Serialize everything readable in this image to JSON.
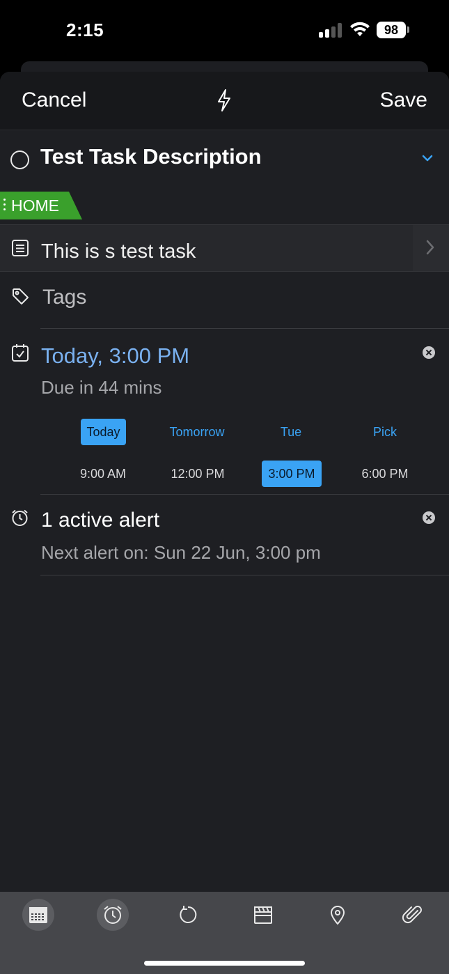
{
  "status_bar": {
    "time": "2:15",
    "battery": "98"
  },
  "nav": {
    "cancel_label": "Cancel",
    "save_label": "Save",
    "center_icon": "bolt-icon"
  },
  "task": {
    "title": "Test Task Description",
    "list_tag": "HOME",
    "list_tag_color": "#3aa02c"
  },
  "notes": {
    "text": "This is s test task"
  },
  "tags": {
    "placeholder": "Tags"
  },
  "due": {
    "date_text": "Today, 3:00 PM",
    "relative_text": "Due in 44 mins",
    "day_options": [
      "Today",
      "Tomorrow",
      "Tue",
      "Pick"
    ],
    "selected_day": "Today",
    "time_options": [
      "9:00 AM",
      "12:00 PM",
      "3:00 PM",
      "6:00 PM"
    ],
    "selected_time": "3:00 PM",
    "accent_color": "#3aa3f4"
  },
  "alert": {
    "title": "1 active alert",
    "next_alert": "Next alert on: Sun 22 Jun, 3:00 pm"
  },
  "toolbar": {
    "items": [
      "calendar-icon",
      "alarm-clock-icon",
      "repeat-icon",
      "clapperboard-icon",
      "location-pin-icon",
      "paperclip-icon"
    ]
  }
}
